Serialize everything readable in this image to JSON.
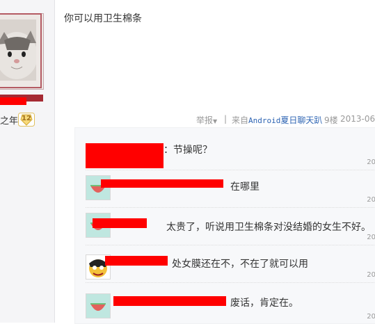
{
  "user": {
    "level_label": "之年",
    "level_number": "12"
  },
  "post": {
    "content": "你可以用卫生棉条",
    "report_label": "举报",
    "separator": "|",
    "source_prefix": "来自",
    "source_app": "Android",
    "source_client": "夏日聊天趴",
    "floor": "9楼",
    "date": "2013-06-"
  },
  "replies": [
    {
      "text": "：节操呢？",
      "time": "20"
    },
    {
      "text": "在哪里",
      "time": "20"
    },
    {
      "text": "太贵了，听说用卫生棉条对没结婚的女生不好。",
      "time": "20"
    },
    {
      "text": "处女膜还在不，不在了就可以用",
      "time": "20"
    },
    {
      "text": "废话，肯定在。",
      "time": "20"
    }
  ],
  "colors": {
    "redaction": "#ff0000",
    "link": "#2d64b3",
    "meta": "#999999"
  }
}
